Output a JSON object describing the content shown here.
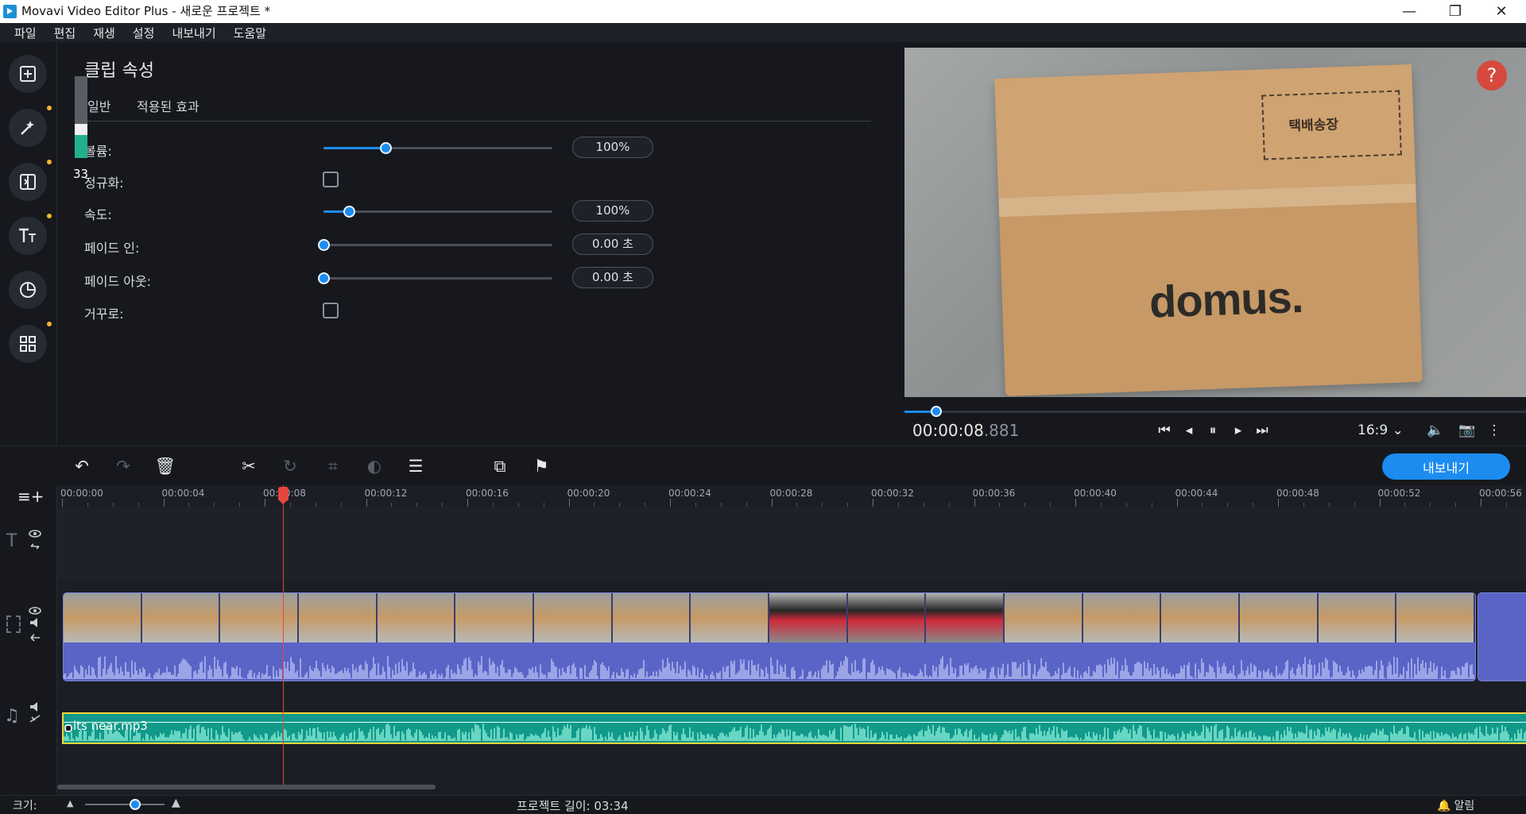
{
  "window": {
    "title": "Movavi Video Editor Plus - 새로운 프로젝트 *",
    "minimize_glyph": "—",
    "restore_glyph": "❐",
    "close_glyph": "✕"
  },
  "menu": [
    "파일",
    "편집",
    "재생",
    "설정",
    "내보내기",
    "도움말"
  ],
  "sidebar": {
    "items": [
      {
        "icon": "import-icon",
        "glyph": "⊞",
        "dot": false
      },
      {
        "icon": "magic-wand-icon",
        "glyph": "✦",
        "dot": true
      },
      {
        "icon": "transitions-icon",
        "glyph": "◧",
        "dot": true
      },
      {
        "icon": "titles-icon",
        "glyph": "Tт",
        "dot": true
      },
      {
        "icon": "stickers-icon",
        "glyph": "◔",
        "dot": false
      },
      {
        "icon": "more-tools-icon",
        "glyph": "⊞",
        "dot": true
      }
    ]
  },
  "properties": {
    "title": "클립 속성",
    "tab_general": "일반",
    "tab_effects": "적용된 효과",
    "level_meter_value": "33",
    "rows": {
      "volume": {
        "label": "볼륨:",
        "value": "100%",
        "level": 0.27
      },
      "normalize": {
        "label": "정규화:",
        "checked": false
      },
      "speed": {
        "label": "속도:",
        "value": "100%",
        "level": 0.11
      },
      "fade_in": {
        "label": "페이드 인:",
        "value": "0.00 초",
        "level": 0.0
      },
      "fade_out": {
        "label": "페이드 아웃:",
        "value": "0.00 초",
        "level": 0.0
      },
      "reverse": {
        "label": "거꾸로:",
        "checked": false
      }
    }
  },
  "preview": {
    "box_logo": "domus.",
    "box_label": "택배송장",
    "help_glyph": "?",
    "progress": 0.04
  },
  "player": {
    "time_main": "00:00:08",
    "time_ms": ".881",
    "aspect": "16:9",
    "aspect_chevron": "⌄",
    "buttons": {
      "skip_start": "⏮",
      "prev_frame": "◂",
      "pause": "⏸",
      "next_frame": "▸",
      "skip_end": "⏭",
      "volume": "🔈",
      "snapshot": "📷",
      "more": "⋮"
    }
  },
  "toolbar": {
    "undo": "↶",
    "redo": "↷",
    "delete": "🗑",
    "cut": "✂",
    "rotate": "↻",
    "crop": "⌗",
    "color": "◐",
    "adjust": "☰",
    "stabilize": "⧉",
    "marker": "⚑",
    "export_label": "내보내기"
  },
  "timeline": {
    "add_track_glyph": "≡+",
    "ticks": [
      "00:00:00",
      "00:00:04",
      "00:00:08",
      "00:00:12",
      "00:00:16",
      "00:00:20",
      "00:00:24",
      "00:00:28",
      "00:00:32",
      "00:00:36",
      "00:00:40",
      "00:00:44",
      "00:00:48",
      "00:00:52",
      "00:00:56"
    ],
    "text_track_glyph": "T",
    "audio_track_glyph": "♫",
    "video_thumbs": [
      "box",
      "box",
      "box",
      "box",
      "box",
      "box",
      "box",
      "box",
      "box",
      "phone",
      "phone",
      "phone",
      "box",
      "box",
      "box",
      "box",
      "box",
      "box"
    ],
    "audio_clip_name": "its near.mp3",
    "playhead_time": "00:00:08.881"
  },
  "status": {
    "size_label": "크기:",
    "project_length": "프로젝트 길이: 03:34",
    "notifications": "알림",
    "bell_glyph": "🔔"
  }
}
